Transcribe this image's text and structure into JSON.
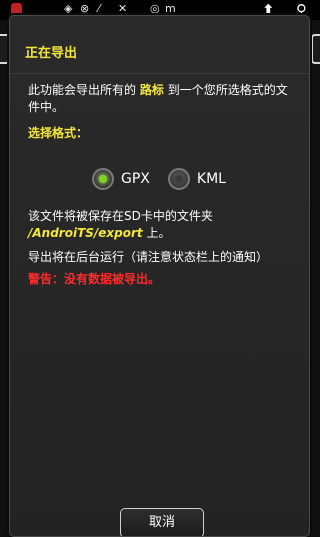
{
  "status_bar": {
    "icons": [
      "app-icon",
      "gps-icon",
      "compass-icon",
      "signal-icon",
      "satellite-icon"
    ],
    "label": "m",
    "right_icons": [
      "home-icon",
      "search-icon"
    ]
  },
  "dialog": {
    "title": "正在导出",
    "intro_before": "此功能会导出所有的",
    "intro_highlight": "路标",
    "intro_after": "到一个您所选格式的文件中。",
    "format_section": "选择格式：",
    "formats": [
      {
        "label": "GPX",
        "selected": true
      },
      {
        "label": "KML",
        "selected": false
      }
    ],
    "save_before": "该文件将被保存在SD卡中的文件夹",
    "save_path": "/AndroiTS/export",
    "save_after": "上。",
    "background_note": "导出将在后台运行（请注意状态栏上的通知）",
    "warning": "警告：没有数据被导出。",
    "cancel_label": "取消",
    "colors": {
      "title": "#f5e63c",
      "warning": "#ff2a2a",
      "radio_on": "#7ed321"
    }
  }
}
